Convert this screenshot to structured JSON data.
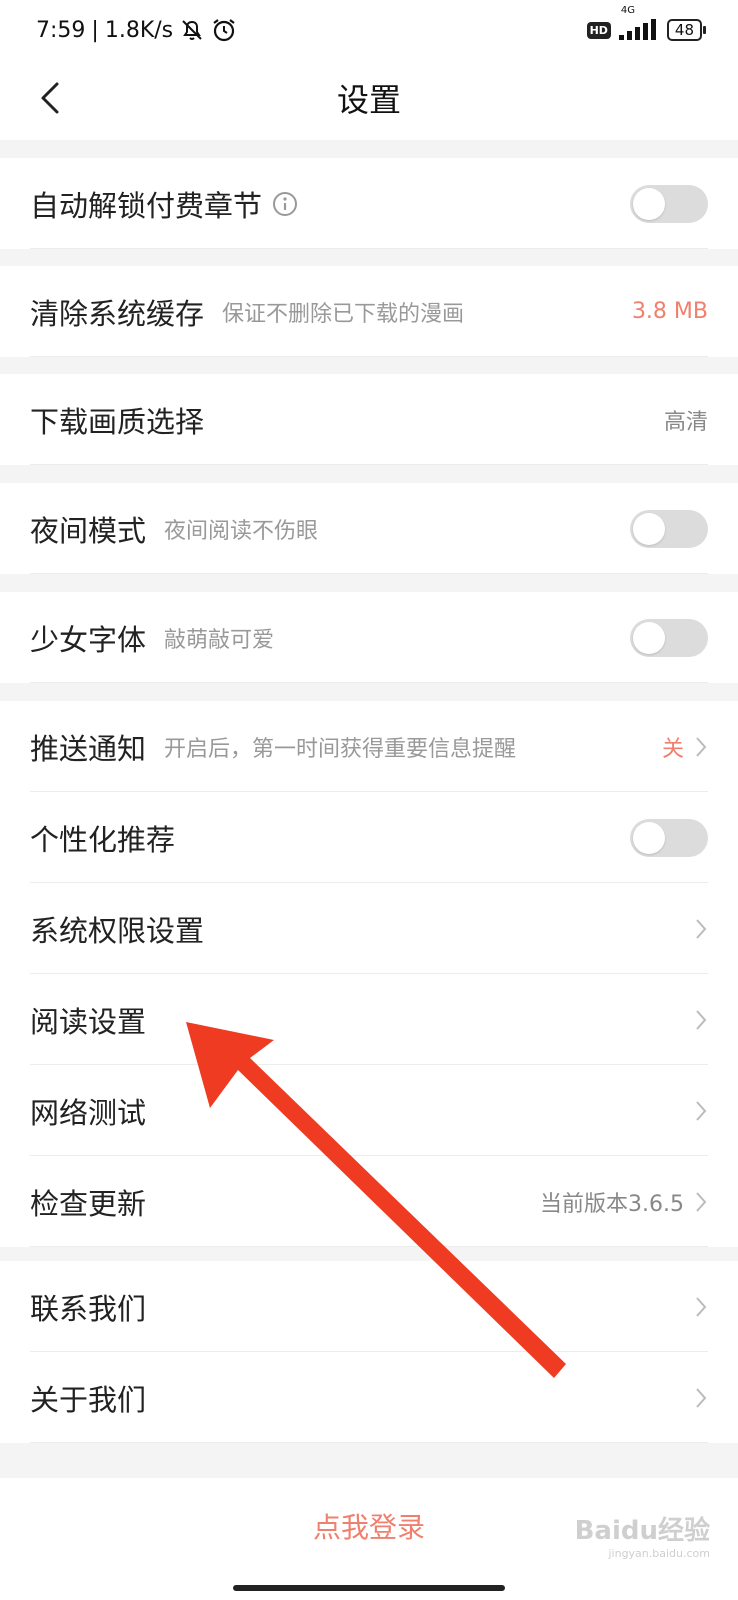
{
  "status": {
    "time": "7:59",
    "network_speed": "1.8K/s",
    "hd": "HD",
    "signal_type": "4G",
    "battery": "48",
    "icons": [
      "bell-off-icon",
      "alarm-icon",
      "signal-icon",
      "battery-icon"
    ]
  },
  "nav": {
    "back_icon": "chevron-left-icon",
    "title": "设置"
  },
  "settings": {
    "auto_unlock": {
      "label": "自动解锁付费章节",
      "icon": "info-icon",
      "enabled": false
    },
    "clear_cache": {
      "label": "清除系统缓存",
      "sub": "保证不删除已下载的漫画",
      "value": "3.8 MB"
    },
    "download_quality": {
      "label": "下载画质选择",
      "value": "高清"
    },
    "night_mode": {
      "label": "夜间模式",
      "sub": "夜间阅读不伤眼",
      "enabled": false
    },
    "girl_font": {
      "label": "少女字体",
      "sub": "敲萌敲可爱",
      "enabled": false
    },
    "push": {
      "label": "推送通知",
      "sub": "开启后，第一时间获得重要信息提醒",
      "value": "关"
    },
    "personalized": {
      "label": "个性化推荐",
      "enabled": false
    },
    "permissions": {
      "label": "系统权限设置"
    },
    "reading": {
      "label": "阅读设置"
    },
    "network_test": {
      "label": "网络测试"
    },
    "check_update": {
      "label": "检查更新",
      "value": "当前版本3.6.5"
    },
    "contact": {
      "label": "联系我们"
    },
    "about": {
      "label": "关于我们"
    }
  },
  "login": {
    "label": "点我登录"
  },
  "watermark": {
    "text": "Baidu经验",
    "domain": "jingyan.baidu.com"
  },
  "colors": {
    "accent": "#f0806e",
    "arrow": "#ee3b22",
    "toggle_off": "#dcdcdc"
  }
}
